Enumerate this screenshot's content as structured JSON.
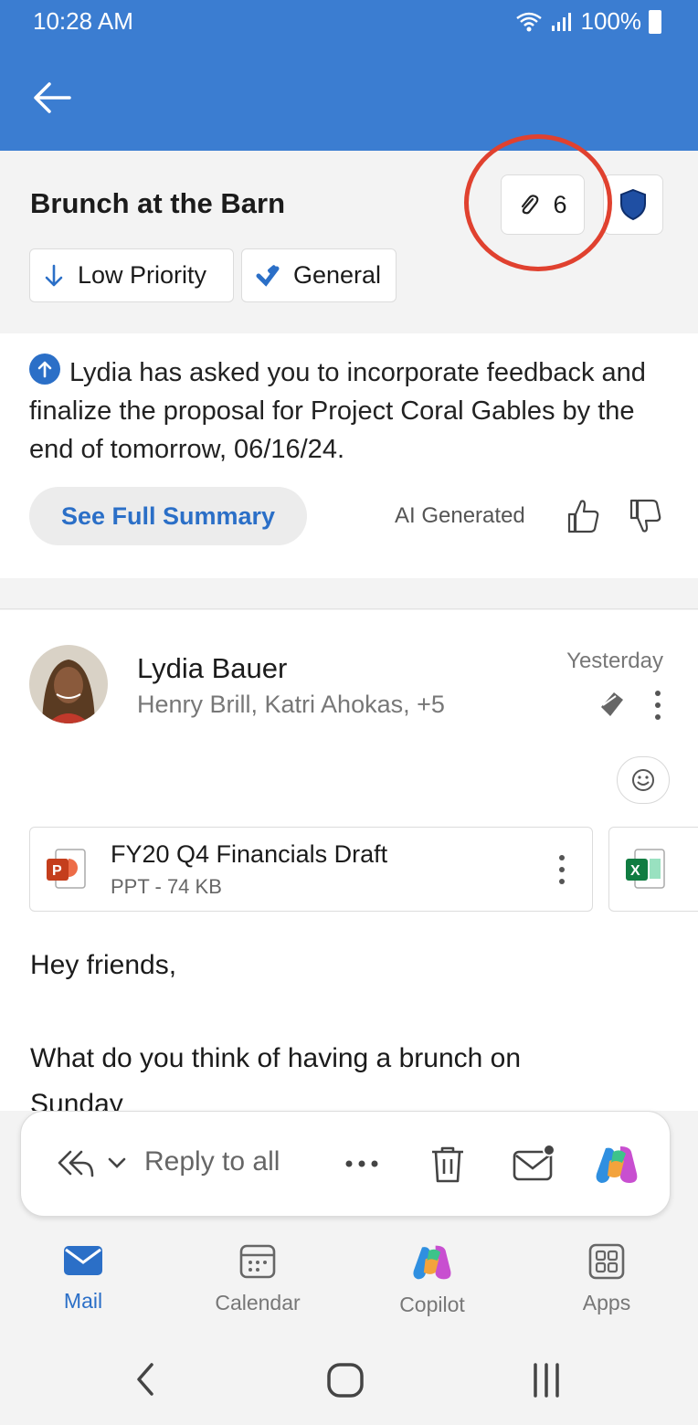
{
  "status_bar": {
    "time": "10:28 AM",
    "battery": "100%"
  },
  "email": {
    "subject": "Brunch at the Barn",
    "attachment_count": "6",
    "chips": [
      {
        "label": "Low Priority",
        "icon": "arrow-down-icon"
      },
      {
        "label": "General",
        "icon": "category-tag-icon"
      }
    ]
  },
  "summary": {
    "text": "Lydia has asked you to incorporate feedback and finalize the proposal for Project Coral Gables by the end of tomorrow, 06/16/24.",
    "button": "See Full Summary",
    "ai_label": "AI Generated"
  },
  "message": {
    "sender": "Lydia Bauer",
    "recipients": "Henry Brill, Katri Ahokas, +5",
    "timestamp": "Yesterday",
    "attachments": [
      {
        "name": "FY20 Q4 Financials Draft",
        "meta": "PPT - 74 KB",
        "icon": "powerpoint-icon"
      },
      {
        "name": "",
        "meta": "",
        "icon": "excel-icon"
      }
    ],
    "body_lines": [
      "Hey friends,",
      "What do you think of having a brunch on",
      "Sunday"
    ]
  },
  "reply_bar": {
    "label": "Reply to all"
  },
  "tabs": [
    {
      "label": "Mail",
      "active": true
    },
    {
      "label": "Calendar",
      "active": false
    },
    {
      "label": "Copilot",
      "active": false
    },
    {
      "label": "Apps",
      "active": false
    }
  ],
  "colors": {
    "brand": "#3b7dd1",
    "accent": "#2b6fc7",
    "highlight": "#e0412f"
  }
}
